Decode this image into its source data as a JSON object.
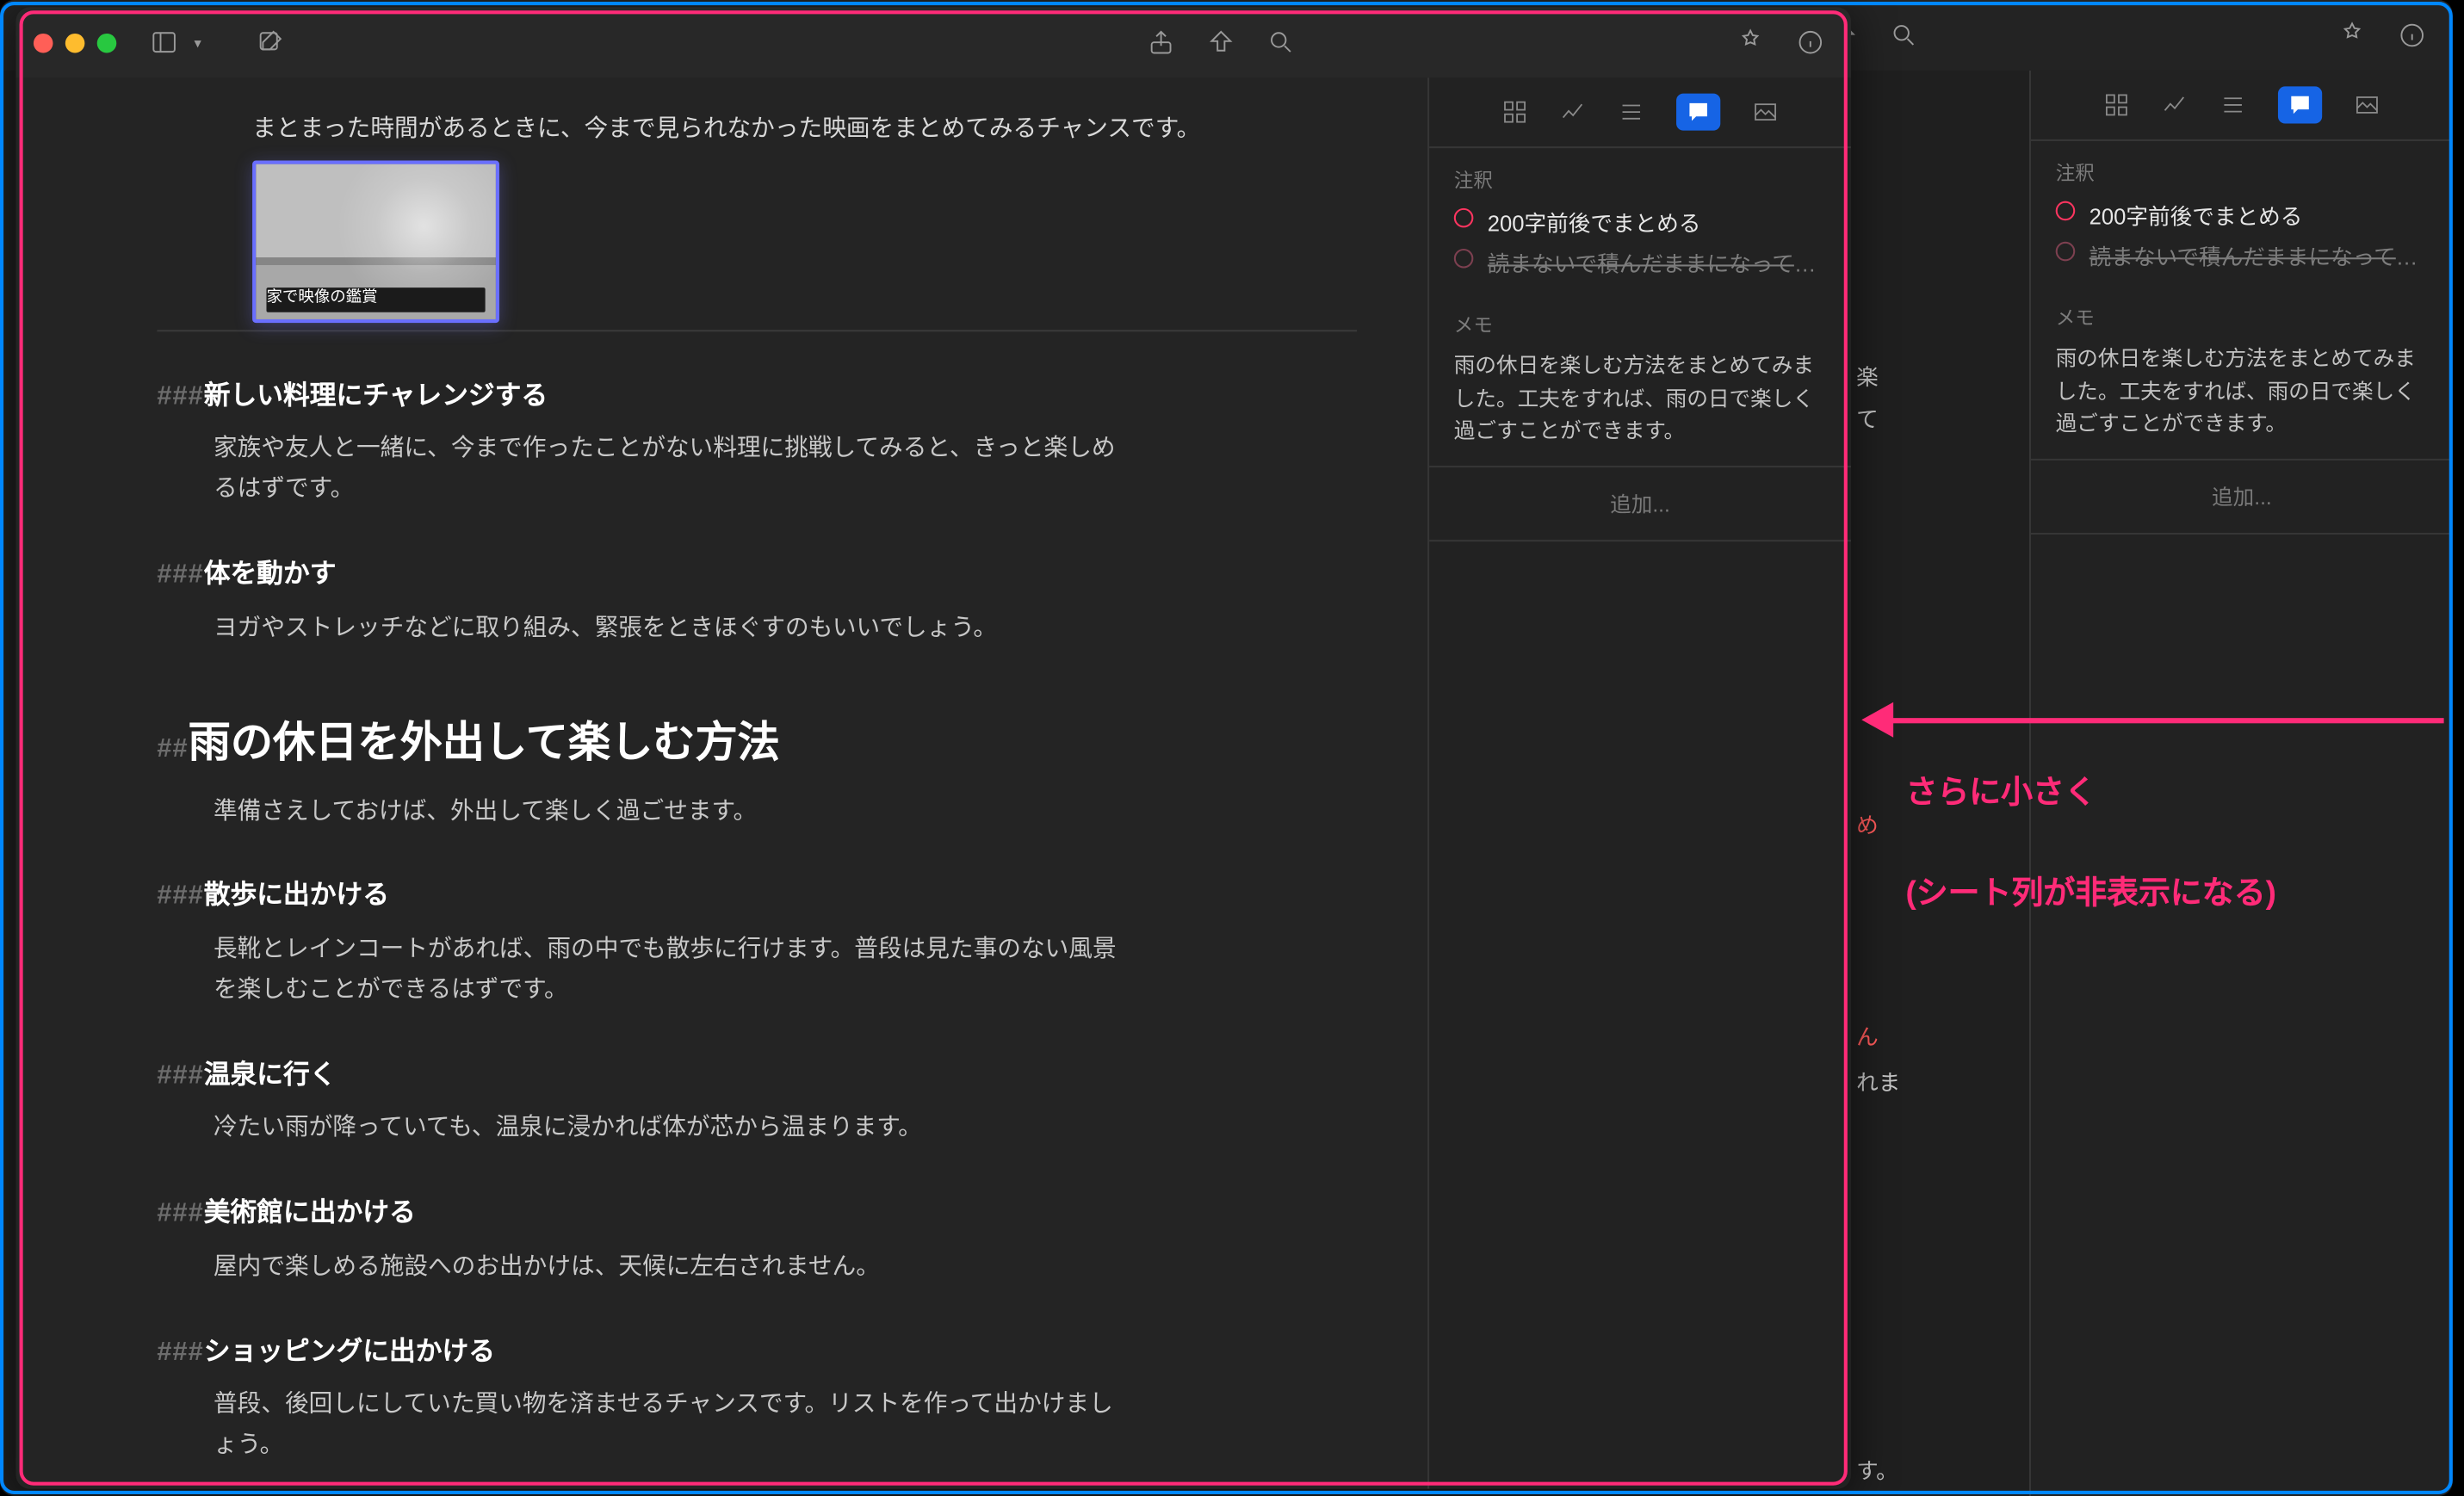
{
  "windows": {
    "front_border_color": "#ff2b78",
    "back_border_color": "#0087ff"
  },
  "toolbar": {
    "sidebar_icon": "sidebar",
    "compose_icon": "compose",
    "share_icon": "share",
    "preview_icon": "preview",
    "search_icon": "search",
    "goal_icon": "goal-badge",
    "info_icon": "info"
  },
  "inspector": {
    "tabs": [
      "grid",
      "stats",
      "outline",
      "comments",
      "media"
    ],
    "active_tab": "comments",
    "notes_label": "注釈",
    "goals": [
      {
        "text": "200字前後でまとめる",
        "done": false
      },
      {
        "text": "読まないで積んだままになっていた本…",
        "done": true
      }
    ],
    "memo_label": "メモ",
    "memo_body": "雨の休日を楽しむ方法をまとめてみました。工夫をすれば、雨の日で楽しく過ごすことができます。",
    "add_label": "追加..."
  },
  "editor": {
    "intro": "まとまった時間があるときに、今まで見られなかった映画をまとめてみるチャンスです。",
    "image_caption": "家で映像の鑑賞",
    "h3_prefix": "###",
    "h2_prefix": "##",
    "s1": {
      "title": "新しい料理にチャレンジする",
      "body": "家族や友人と一緒に、今まで作ったことがない料理に挑戦してみると、きっと楽しめるはずです。"
    },
    "s2": {
      "title": "体を動かす",
      "body": "ヨガやストレッチなどに取り組み、緊張をときほぐすのもいいでしょう。"
    },
    "h2": {
      "title": "雨の休日を外出して楽しむ方法",
      "body": "準備さえしておけば、外出して楽しく過ごせます。"
    },
    "s3": {
      "title": "散歩に出かける",
      "body": "長靴とレインコートがあれば、雨の中でも散歩に行けます。普段は見た事のない風景を楽しむことができるはずです。"
    },
    "s4": {
      "title": "温泉に行く",
      "body": "冷たい雨が降っていても、温泉に浸かれば体が芯から温まります。"
    },
    "s5": {
      "title": "美術館に出かける",
      "body": "屋内で楽しめる施設へのお出かけは、天候に左右されません。"
    },
    "s6": {
      "title": "ショッピングに出かける",
      "body": "普段、後回しにしていた買い物を済ませるチャンスです。リストを作って出かけましょう。"
    }
  },
  "peek": {
    "lines": [
      "楽",
      "て",
      "め",
      "ん",
      "れま",
      "す。"
    ]
  },
  "annotation": {
    "line1": "さらに小さく",
    "line2": "(シート列が非表示になる)"
  }
}
